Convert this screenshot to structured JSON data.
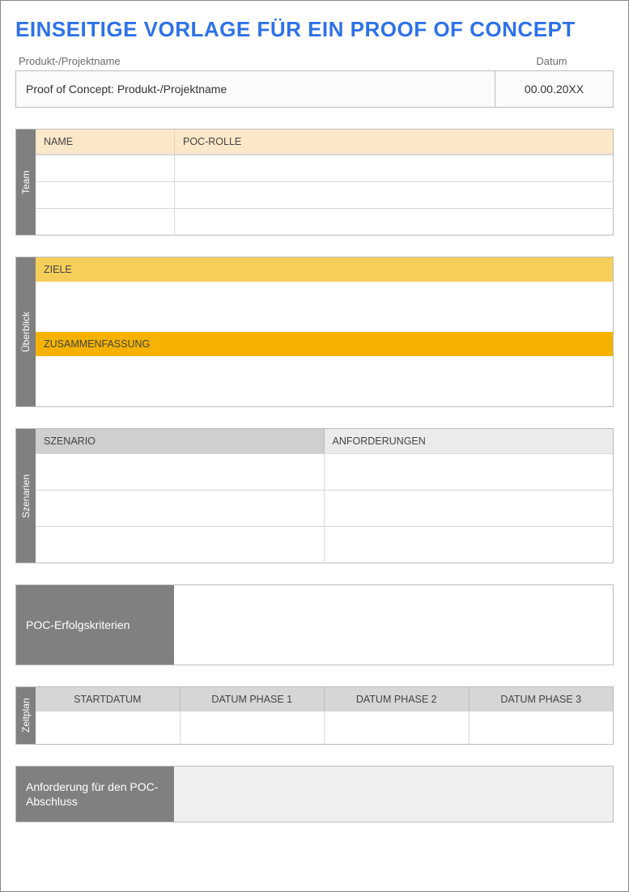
{
  "title": "EINSEITIGE VORLAGE FÜR EIN PROOF OF CONCEPT",
  "meta": {
    "name_label": "Produkt-/Projektname",
    "date_label": "Datum",
    "name_value": "Proof of Concept: Produkt-/Projektname",
    "date_value": "00.00.20XX"
  },
  "team": {
    "tab": "Team",
    "headers": {
      "name": "NAME",
      "role": "POC-ROLLE"
    },
    "rows": [
      {
        "name": "",
        "role": ""
      },
      {
        "name": "",
        "role": ""
      },
      {
        "name": "",
        "role": ""
      }
    ]
  },
  "overview": {
    "tab": "Überblick",
    "goals_label": "ZIELE",
    "goals_value": "",
    "summary_label": "ZUSAMMENFASSUNG",
    "summary_value": ""
  },
  "scenarios": {
    "tab": "Szenarien",
    "headers": {
      "scenario": "SZENARIO",
      "requirements": "ANFORDERUNGEN"
    },
    "rows": [
      {
        "scenario": "",
        "requirements": ""
      },
      {
        "scenario": "",
        "requirements": ""
      },
      {
        "scenario": "",
        "requirements": ""
      }
    ]
  },
  "criteria": {
    "label": "POC-Erfolgskriterien",
    "value": ""
  },
  "timeline": {
    "tab": "Zeitplan",
    "headers": {
      "start": "STARTDATUM",
      "p1": "DATUM PHASE 1",
      "p2": "DATUM PHASE 2",
      "p3": "DATUM PHASE 3"
    },
    "values": {
      "start": "",
      "p1": "",
      "p2": "",
      "p3": ""
    }
  },
  "closure": {
    "label": "Anforderung für den POC-Abschluss",
    "value": ""
  }
}
